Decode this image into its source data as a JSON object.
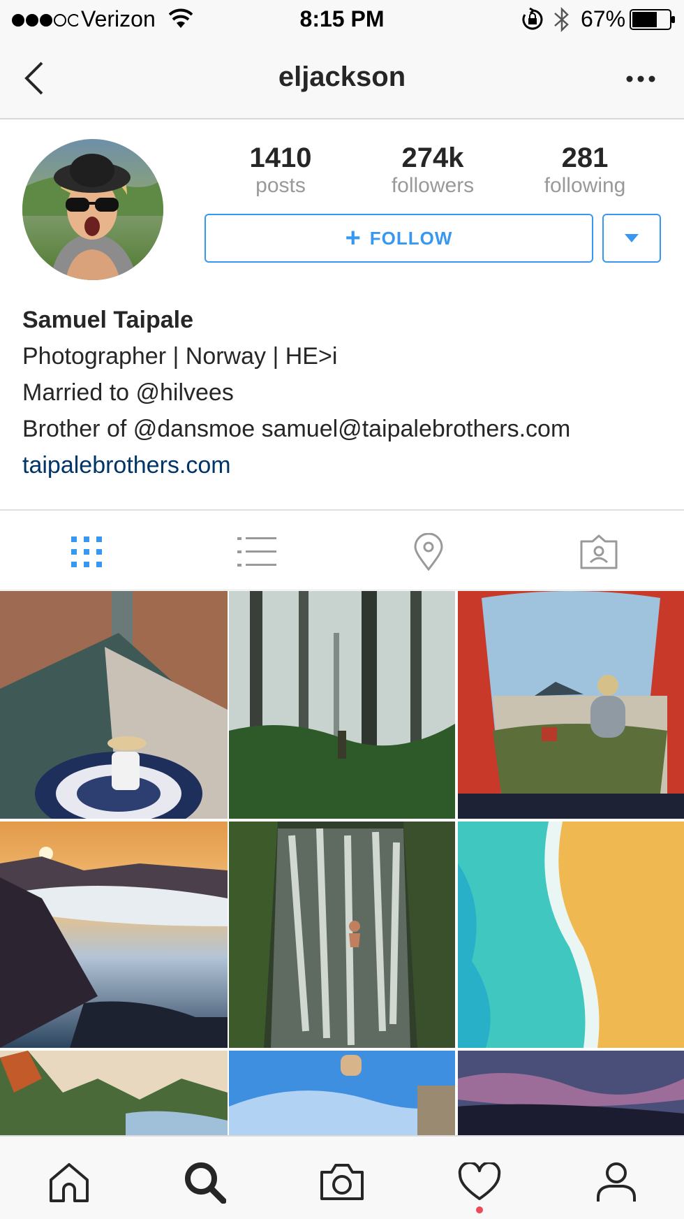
{
  "status_bar": {
    "carrier": "Verizon",
    "signal_bars": 3,
    "time": "8:15 PM",
    "battery": "67%",
    "battery_level": 0.67
  },
  "nav": {
    "title": "eljackson",
    "back_icon": "chevron-left-icon",
    "more_icon": "more-horizontal-icon"
  },
  "profile": {
    "stats": [
      {
        "value": "1410",
        "label": "posts"
      },
      {
        "value": "274k",
        "label": "followers"
      },
      {
        "value": "281",
        "label": "following"
      }
    ],
    "follow_label": "FOLLOW",
    "name": "Samuel Taipale",
    "bio_lines": [
      "Photographer | Norway | HE>i",
      "Married to @hilvees",
      "Brother of @dansmoe samuel@taipalebrothers.com"
    ],
    "website": "taipalebrothers.com"
  },
  "tabs": [
    {
      "name": "grid-view-tab",
      "icon": "grid-icon",
      "active": true
    },
    {
      "name": "list-view-tab",
      "icon": "list-icon",
      "active": false
    },
    {
      "name": "map-view-tab",
      "icon": "location-pin-icon",
      "active": false
    },
    {
      "name": "tagged-photos-tab",
      "icon": "tagged-person-icon",
      "active": false
    }
  ],
  "colors": {
    "accent": "#3897f0",
    "link": "#003569",
    "text": "#262626",
    "muted": "#999999",
    "notification_dot": "#ed4956"
  },
  "bottom_nav": [
    {
      "name": "home-tab",
      "icon": "home-icon"
    },
    {
      "name": "search-tab",
      "icon": "search-icon",
      "active": true
    },
    {
      "name": "camera-tab",
      "icon": "camera-icon"
    },
    {
      "name": "activity-tab",
      "icon": "heart-icon",
      "has_notification": true
    },
    {
      "name": "profile-tab",
      "icon": "user-icon"
    }
  ]
}
